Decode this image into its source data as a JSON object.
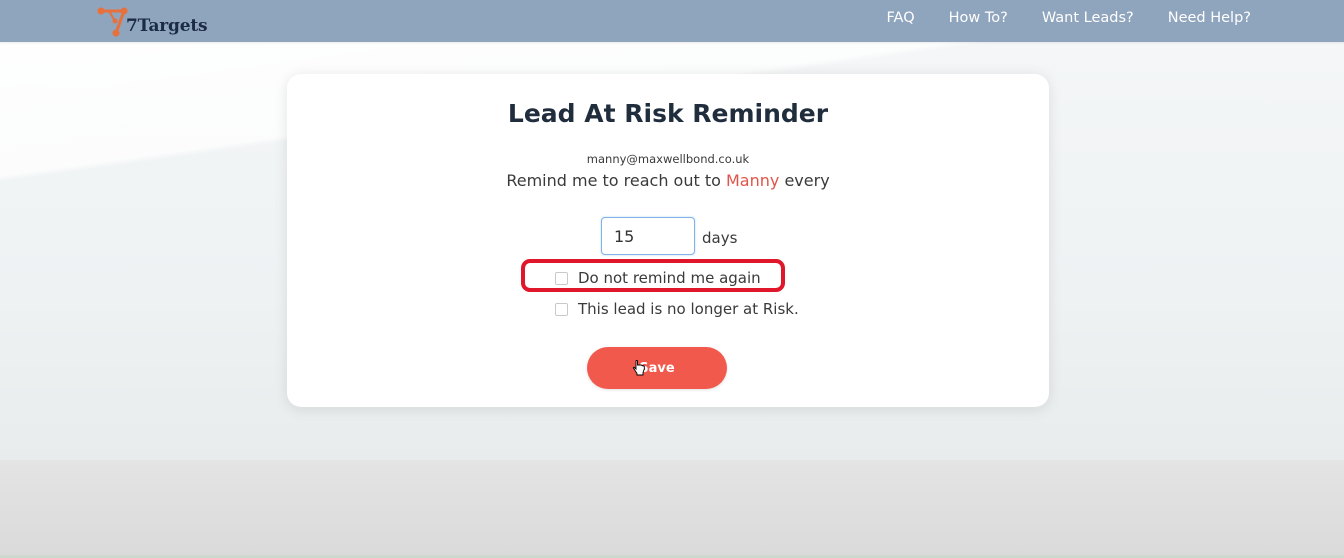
{
  "header": {
    "logo_text": "7Targets",
    "nav": [
      "FAQ",
      "How To?",
      "Want Leads?",
      "Need Help?"
    ]
  },
  "card": {
    "title": "Lead At Risk Reminder",
    "email": "manny@maxwellbond.co.uk",
    "remind_prefix": "Remind me to reach out to",
    "remind_name": "Manny",
    "remind_suffix": "every",
    "days_value": "15",
    "days_label": "days",
    "checkbox_1": "Do not remind me again",
    "checkbox_2": "This lead is no longer at Risk.",
    "save_label": "Save"
  },
  "colors": {
    "header_bg": "#8fa4bd",
    "accent": "#f2594d",
    "highlight": "#e0162b",
    "name_color": "#e0544a"
  },
  "icons": {
    "logo": "network-nodes-logo",
    "cursor": "hand-pointer-icon"
  }
}
